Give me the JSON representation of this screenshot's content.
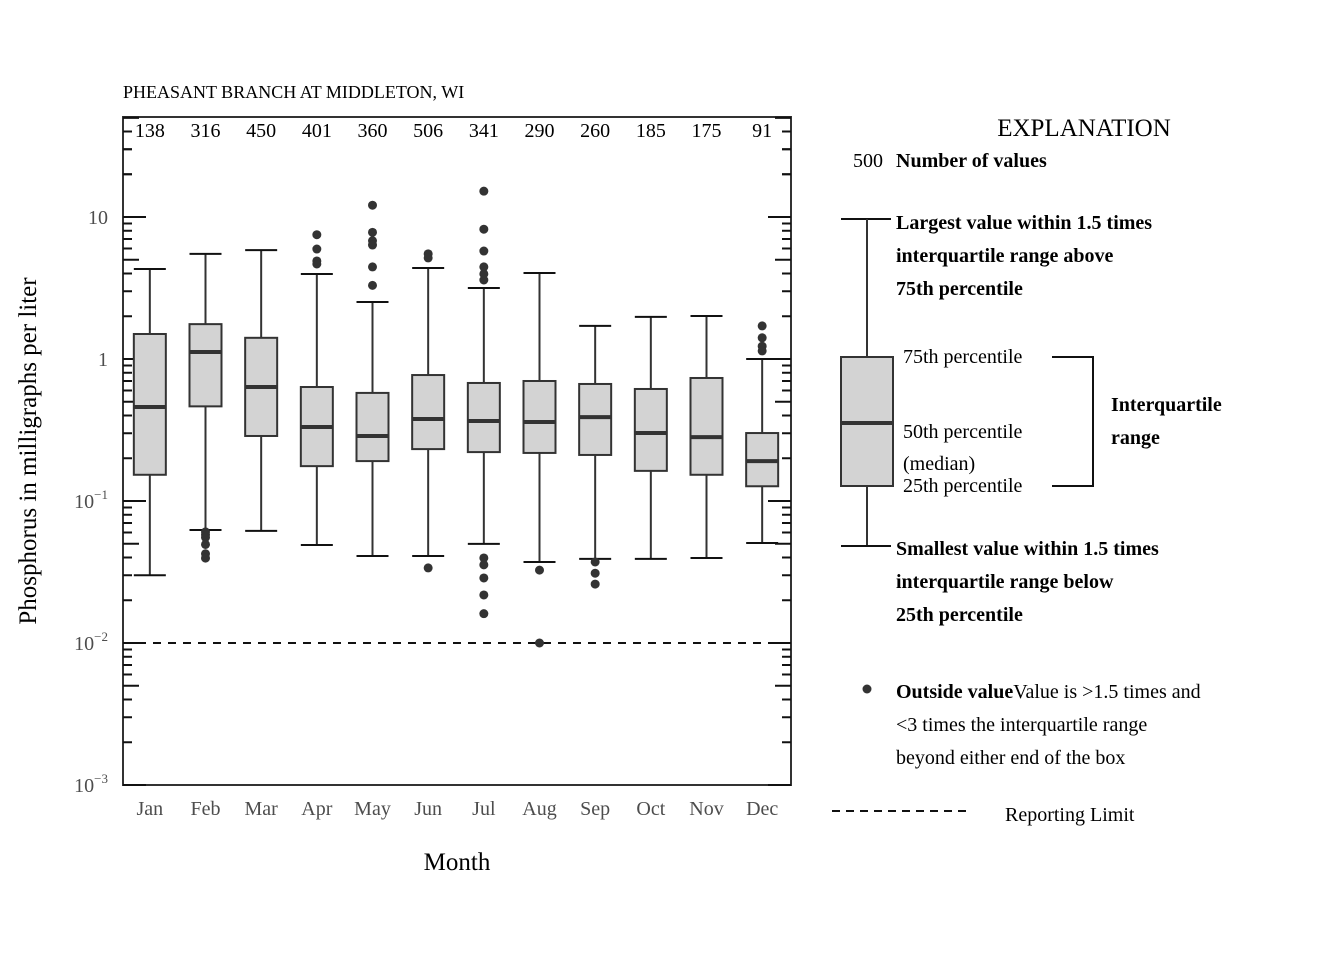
{
  "chart_data": {
    "type": "boxplot",
    "title": "PHEASANT BRANCH AT MIDDLETON, WI",
    "xlabel": "Month",
    "ylabel": "Phosphorus in milligraphs per liter",
    "yscale": "log",
    "ylim": [
      0.001,
      50
    ],
    "ytick_labels": [
      {
        "value": 0.001,
        "base": "10",
        "exp": "−3"
      },
      {
        "value": 0.01,
        "base": "10",
        "exp": "−2"
      },
      {
        "value": 0.1,
        "base": "10",
        "exp": "−1"
      },
      {
        "value": 1,
        "base": "1",
        "exp": ""
      },
      {
        "value": 10,
        "base": "10",
        "exp": ""
      }
    ],
    "reporting_limit": 0.01,
    "categories": [
      "Jan",
      "Feb",
      "Mar",
      "Apr",
      "May",
      "Jun",
      "Jul",
      "Aug",
      "Sep",
      "Oct",
      "Nov",
      "Dec"
    ],
    "counts": [
      "138",
      "316",
      "450",
      "401",
      "360",
      "506",
      "341",
      "290",
      "260",
      "185",
      "175",
      "91"
    ],
    "boxes": [
      {
        "month": "Jan",
        "whisker_low": 0.03,
        "q1": 0.153,
        "median": 0.459,
        "q3": 1.5,
        "whisker_high": 4.3,
        "outliers": []
      },
      {
        "month": "Feb",
        "whisker_low": 0.0625,
        "q1": 0.464,
        "median": 1.12,
        "q3": 1.76,
        "whisker_high": 5.5,
        "outliers": [
          0.0606,
          0.0578,
          0.0554,
          0.0494,
          0.0425,
          0.0396
        ]
      },
      {
        "month": "Mar",
        "whisker_low": 0.0616,
        "q1": 0.287,
        "median": 0.635,
        "q3": 1.41,
        "whisker_high": 5.85,
        "outliers": []
      },
      {
        "month": "Apr",
        "whisker_low": 0.049,
        "q1": 0.176,
        "median": 0.332,
        "q3": 0.635,
        "whisker_high": 3.97,
        "outliers": [
          7.5,
          5.95,
          4.9,
          4.67
        ]
      },
      {
        "month": "May",
        "whisker_low": 0.041,
        "q1": 0.191,
        "median": 0.287,
        "q3": 0.577,
        "whisker_high": 2.52,
        "outliers": [
          12.1,
          7.8,
          6.8,
          6.35,
          4.45,
          3.3
        ]
      },
      {
        "month": "Jun",
        "whisker_low": 0.041,
        "q1": 0.232,
        "median": 0.378,
        "q3": 0.771,
        "whisker_high": 4.37,
        "outliers": [
          5.5,
          5.15,
          0.0338
        ]
      },
      {
        "month": "Jul",
        "whisker_low": 0.0499,
        "q1": 0.221,
        "median": 0.366,
        "q3": 0.678,
        "whisker_high": 3.16,
        "outliers": [
          15.2,
          8.2,
          5.76,
          4.45,
          3.97,
          3.6,
          0.0397,
          0.0355,
          0.0287,
          0.0218,
          0.0161
        ]
      },
      {
        "month": "Aug",
        "whisker_low": 0.0372,
        "q1": 0.218,
        "median": 0.36,
        "q3": 0.7,
        "whisker_high": 4.03,
        "outliers": [
          0.0326,
          0.01
        ]
      },
      {
        "month": "Sep",
        "whisker_low": 0.0391,
        "q1": 0.211,
        "median": 0.39,
        "q3": 0.667,
        "whisker_high": 1.71,
        "outliers": [
          0.0372,
          0.031,
          0.026
        ]
      },
      {
        "month": "Oct",
        "whisker_low": 0.0391,
        "q1": 0.163,
        "median": 0.301,
        "q3": 0.615,
        "whisker_high": 1.98,
        "outliers": []
      },
      {
        "month": "Nov",
        "whisker_low": 0.0397,
        "q1": 0.153,
        "median": 0.282,
        "q3": 0.735,
        "whisker_high": 2.01,
        "outliers": []
      },
      {
        "month": "Dec",
        "whisker_low": 0.0506,
        "q1": 0.127,
        "median": 0.191,
        "q3": 0.301,
        "whisker_high": 1.0,
        "outliers": [
          1.71,
          1.41,
          1.23,
          1.14
        ]
      }
    ],
    "colors": {
      "box_fill": "#d3d3d3",
      "box_stroke": "#333333",
      "outlier": "#333333",
      "tick_label": "#4d4d4d",
      "text": "#000000"
    },
    "legend": {
      "placement": "right",
      "title": "EXPLANATION",
      "count_example": "500",
      "count_label": "Number of values",
      "whisker_high_lines": [
        "Largest value within 1.5 times",
        "interquartile range above",
        "75th percentile"
      ],
      "q3_label": "75th percentile",
      "median_label_1": "50th percentile",
      "median_label_2": "(median)",
      "q1_label": "25th percentile",
      "iqr_lines": [
        "Interquartile",
        "range"
      ],
      "whisker_low_lines": [
        "Smallest value within 1.5 times",
        "interquartile range below",
        "25th percentile"
      ],
      "outlier_bold": "Outside value",
      "outlier_lines": [
        "Value is >1.5 times and",
        "<3 times the interquartile range",
        "beyond either end of the box"
      ],
      "reporting_limit_label": "Reporting Limit"
    }
  }
}
